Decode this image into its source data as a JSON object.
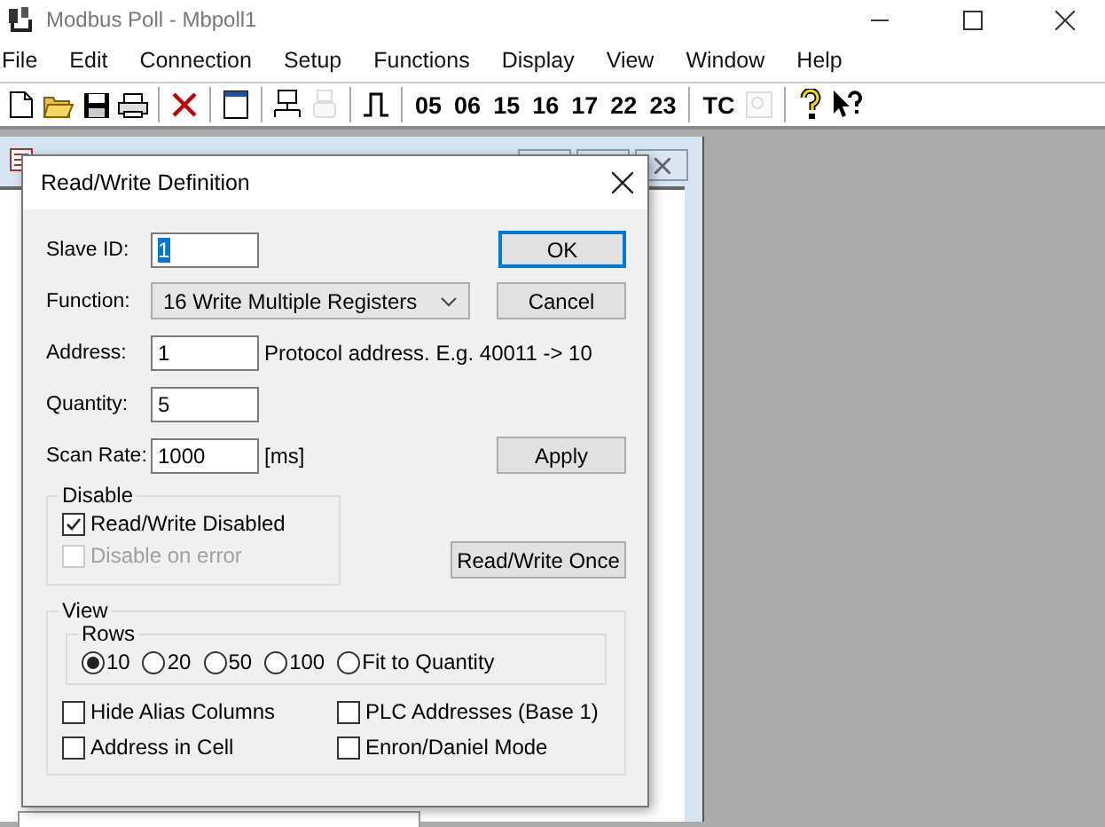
{
  "window": {
    "title": "Modbus Poll - Mbpoll1"
  },
  "menu": [
    "File",
    "Edit",
    "Connection",
    "Setup",
    "Functions",
    "Display",
    "View",
    "Window",
    "Help"
  ],
  "toolbar": [
    {
      "kind": "new",
      "disabled": false
    },
    {
      "kind": "open",
      "disabled": false
    },
    {
      "kind": "save",
      "disabled": false
    },
    {
      "kind": "print",
      "disabled": false
    },
    {
      "kind": "separator"
    },
    {
      "kind": "delete",
      "disabled": false
    },
    {
      "kind": "separator"
    },
    {
      "kind": "window",
      "disabled": false
    },
    {
      "kind": "separator"
    },
    {
      "kind": "connect",
      "disabled": false
    },
    {
      "kind": "disconnect",
      "disabled": true
    },
    {
      "kind": "separator"
    },
    {
      "kind": "pulse",
      "disabled": false
    },
    {
      "kind": "separator"
    },
    {
      "kind": "text",
      "label": "05",
      "disabled": false
    },
    {
      "kind": "text",
      "label": "06",
      "disabled": false
    },
    {
      "kind": "text",
      "label": "15",
      "disabled": false
    },
    {
      "kind": "text",
      "label": "16",
      "disabled": false
    },
    {
      "kind": "text",
      "label": "17",
      "disabled": false
    },
    {
      "kind": "text",
      "label": "22",
      "disabled": false
    },
    {
      "kind": "text",
      "label": "23",
      "disabled": false
    },
    {
      "kind": "separator"
    },
    {
      "kind": "text",
      "label": "TC",
      "disabled": false
    },
    {
      "kind": "monitor",
      "disabled": true
    },
    {
      "kind": "separator"
    },
    {
      "kind": "help",
      "disabled": false
    },
    {
      "kind": "context-help",
      "disabled": false
    }
  ],
  "dialog": {
    "title": "Read/Write Definition",
    "slave_id": {
      "label": "Slave ID:",
      "value": "1",
      "text_selected": true
    },
    "function": {
      "label": "Function:",
      "value": "16 Write Multiple Registers"
    },
    "address": {
      "label": "Address:",
      "value": "1",
      "hint": "Protocol address. E.g. 40011 -> 10"
    },
    "quantity": {
      "label": "Quantity:",
      "value": "5"
    },
    "scan_rate": {
      "label": "Scan Rate:",
      "value": "1000",
      "unit": "[ms]"
    },
    "ok_button": {
      "label": "OK",
      "default": true
    },
    "cancel_button": {
      "label": "Cancel",
      "default": false
    },
    "apply_button": {
      "label": "Apply",
      "default": false
    },
    "once_button": {
      "label": "Read/Write Once",
      "default": false
    },
    "disable_group": {
      "title": "Disable",
      "options": [
        {
          "label": "Read/Write Disabled",
          "checked": true,
          "disabled": false
        },
        {
          "label": "Disable on error",
          "checked": false,
          "disabled": true
        }
      ]
    },
    "view_group": {
      "title": "View",
      "rows": {
        "title": "Rows",
        "options": [
          {
            "label": "10",
            "selected": true
          },
          {
            "label": "20",
            "selected": false
          },
          {
            "label": "50",
            "selected": false
          },
          {
            "label": "100",
            "selected": false
          },
          {
            "label": "Fit to Quantity",
            "selected": false
          }
        ]
      },
      "options": [
        {
          "label": "Hide Alias Columns",
          "checked": false
        },
        {
          "label": "PLC Addresses (Base 1)",
          "checked": false
        },
        {
          "label": "Address in Cell",
          "checked": false
        },
        {
          "label": "Enron/Daniel Mode",
          "checked": false
        }
      ]
    }
  }
}
